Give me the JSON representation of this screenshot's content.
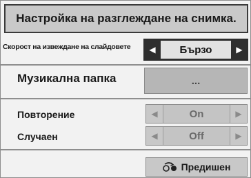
{
  "dialog": {
    "title": "Настройка на разглеждане на снимка."
  },
  "settings": {
    "slide_speed": {
      "label": "Скорост на извеждане на слайдовете",
      "value": "Бързо",
      "left_arrow": "◀",
      "right_arrow": "▶"
    },
    "music_folder": {
      "label": "Музикална папка",
      "button": "..."
    },
    "repeat": {
      "label": "Повторение",
      "value": "On",
      "left_arrow": "◀",
      "right_arrow": "▶"
    },
    "shuffle": {
      "label": "Случаен",
      "value": "Off",
      "left_arrow": "◀",
      "right_arrow": "▶"
    }
  },
  "footer": {
    "back_label": "Предишен",
    "back_icon": "back-remote-icon"
  }
}
